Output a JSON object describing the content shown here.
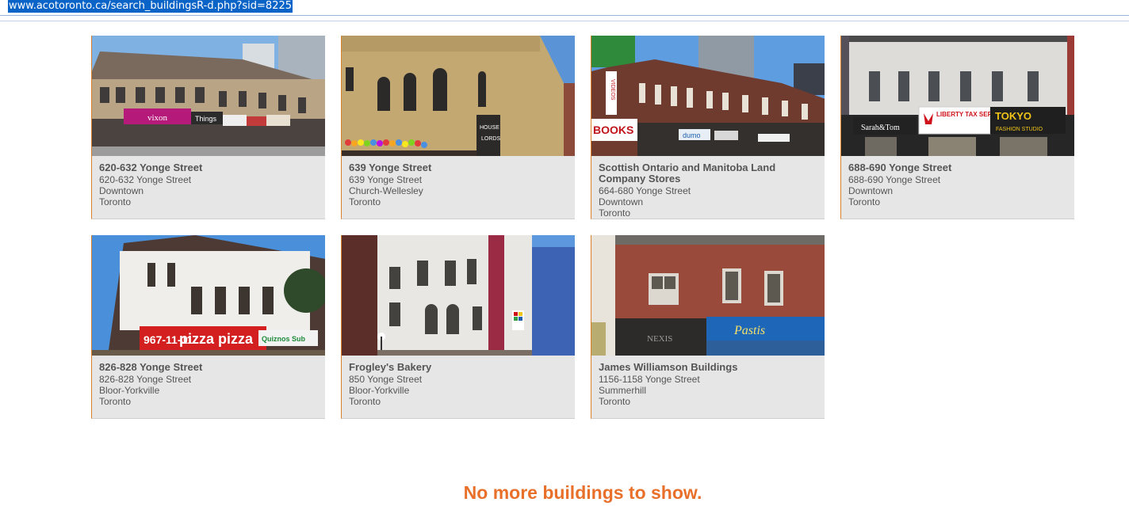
{
  "browser": {
    "url": "www.acotoronto.ca/search_buildingsR-d.php?sid=8225"
  },
  "buildings": [
    {
      "title": "620-632 Yonge Street",
      "address": "620-632 Yonge Street",
      "district": "Downtown",
      "city": "Toronto",
      "signs": [
        "vixon",
        "Things"
      ]
    },
    {
      "title": "639 Yonge Street",
      "address": "639 Yonge Street",
      "district": "Church-Wellesley",
      "city": "Toronto",
      "signs": [
        "HOUSE",
        "LORDS"
      ]
    },
    {
      "title": "Scottish Ontario and Manitoba Land Company Stores",
      "address": "664-680 Yonge Street",
      "district": "Downtown",
      "city": "Toronto",
      "signs": [
        "BOOKS",
        "VIDEOS",
        "dumo"
      ]
    },
    {
      "title": "688-690 Yonge Street",
      "address": "688-690 Yonge Street",
      "district": "Downtown",
      "city": "Toronto",
      "signs": [
        "Sarah&Tom",
        "LIBERTY TAX SERVICE",
        "TOKYO",
        "FASHION STUDIO"
      ]
    },
    {
      "title": "826-828 Yonge Street",
      "address": "826-828 Yonge Street",
      "district": "Bloor-Yorkville",
      "city": "Toronto",
      "signs": [
        "967-11-11",
        "pizza pizza",
        "Quiznos Sub"
      ]
    },
    {
      "title": "Frogley's Bakery",
      "address": "850 Yonge Street",
      "district": "Bloor-Yorkville",
      "city": "Toronto",
      "signs": []
    },
    {
      "title": "James Williamson Buildings",
      "address": "1156-1158 Yonge Street",
      "district": "Summerhill",
      "city": "Toronto",
      "signs": [
        "NEXIS",
        "Pastis"
      ]
    }
  ],
  "footer": {
    "message": "No more buildings to show."
  }
}
